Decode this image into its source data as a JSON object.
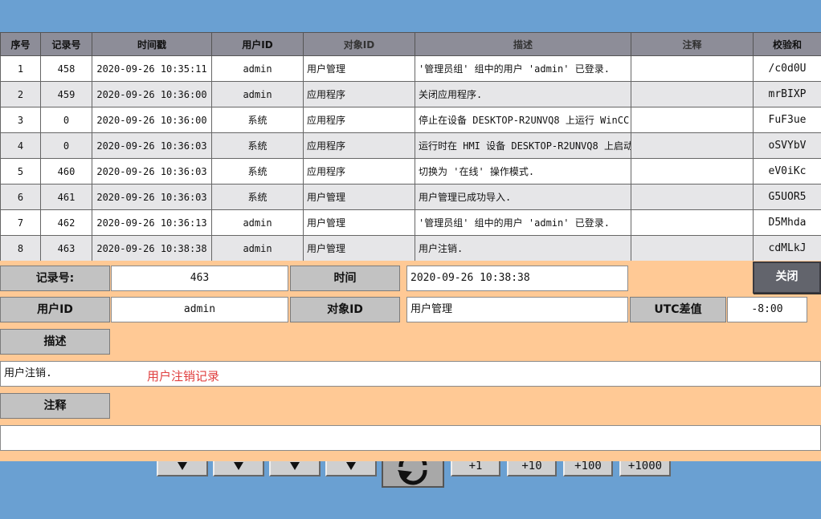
{
  "table": {
    "headers": [
      "序号",
      "记录号",
      "时间戳",
      "用户ID",
      "对象ID",
      "描述",
      "注释",
      "校验和"
    ],
    "rows": [
      {
        "seq": "1",
        "rec": "458",
        "time": "2020-09-26 10:35:11",
        "user": "admin",
        "obj": "用户管理",
        "desc": "'管理员组' 组中的用户 'admin' 已登录.",
        "note": "",
        "sum": "/c0d0U"
      },
      {
        "seq": "2",
        "rec": "459",
        "time": "2020-09-26 10:36:00",
        "user": "admin",
        "obj": "应用程序",
        "desc": "关闭应用程序.",
        "note": "",
        "sum": "mrBIXP"
      },
      {
        "seq": "3",
        "rec": "0",
        "time": "2020-09-26 10:36:00",
        "user": "系统",
        "obj": "应用程序",
        "desc": "停止在设备 DESKTOP-R2UNVQ8 上运行 WinCC",
        "note": "",
        "sum": "FuF3ue"
      },
      {
        "seq": "4",
        "rec": "0",
        "time": "2020-09-26 10:36:03",
        "user": "系统",
        "obj": "应用程序",
        "desc": "运行时在 HMI 设备 DESKTOP-R2UNVQ8 上启动",
        "note": "",
        "sum": "oSVYbV"
      },
      {
        "seq": "5",
        "rec": "460",
        "time": "2020-09-26 10:36:03",
        "user": "系统",
        "obj": "应用程序",
        "desc": "切换为 '在线' 操作模式.",
        "note": "",
        "sum": "eV0iKc"
      },
      {
        "seq": "6",
        "rec": "461",
        "time": "2020-09-26 10:36:03",
        "user": "系统",
        "obj": "用户管理",
        "desc": "用户管理已成功导入.",
        "note": "",
        "sum": "G5UOR5"
      },
      {
        "seq": "7",
        "rec": "462",
        "time": "2020-09-26 10:36:13",
        "user": "admin",
        "obj": "用户管理",
        "desc": "'管理员组' 组中的用户 'admin' 已登录.",
        "note": "",
        "sum": "D5Mhda"
      },
      {
        "seq": "8",
        "rec": "463",
        "time": "2020-09-26 10:38:38",
        "user": "admin",
        "obj": "用户管理",
        "desc": "用户注销.",
        "note": "",
        "sum": "cdMLkJ"
      }
    ]
  },
  "detail": {
    "record_label": "记录号:",
    "record_value": "463",
    "time_label": "时间",
    "time_value": "2020-09-26 10:38:38",
    "close_label": "关闭",
    "user_label": "用户ID",
    "user_value": "admin",
    "object_label": "对象ID",
    "object_value": "用户管理",
    "utc_label": "UTC差值",
    "utc_value": "-8:00",
    "desc_label": "描述",
    "desc_value": "用户注销.",
    "desc_hint": "用户注销记录",
    "note_label": "注释",
    "note_value": ""
  },
  "nav": {
    "step_labels": [
      "+1",
      "+10",
      "+100",
      "+1000"
    ]
  }
}
